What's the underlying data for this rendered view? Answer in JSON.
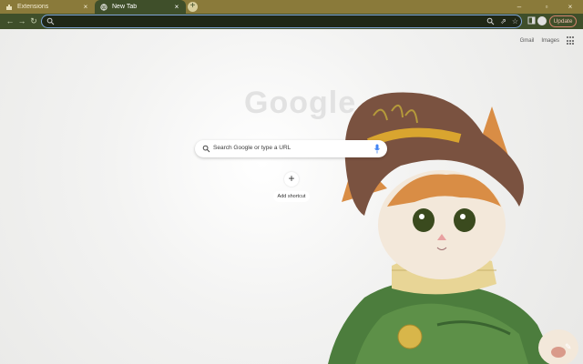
{
  "tabs": [
    {
      "title": "Extensions",
      "active": false
    },
    {
      "title": "New Tab",
      "active": true
    }
  ],
  "toolbar": {
    "address_value": "",
    "update_label": "Update"
  },
  "ntp": {
    "gmail_label": "Gmail",
    "images_label": "Images",
    "logo_text": "Google",
    "search_placeholder": "Search Google or type a URL",
    "add_shortcut_label": "Add shortcut"
  },
  "colors": {
    "frame": "#8a7a3a",
    "toolbar": "#3f4f2a",
    "omnibox_border": "#7fa5d8",
    "update_border": "#d6846f"
  },
  "icons": [
    "extensions-icon",
    "globe-icon",
    "close-icon",
    "new-tab-icon",
    "back-icon",
    "forward-icon",
    "reload-icon",
    "lock-icon",
    "search-icon",
    "share-icon",
    "star-icon",
    "side-panel-icon",
    "avatar",
    "apps-icon",
    "mic-icon",
    "plus-icon",
    "pencil-icon"
  ]
}
